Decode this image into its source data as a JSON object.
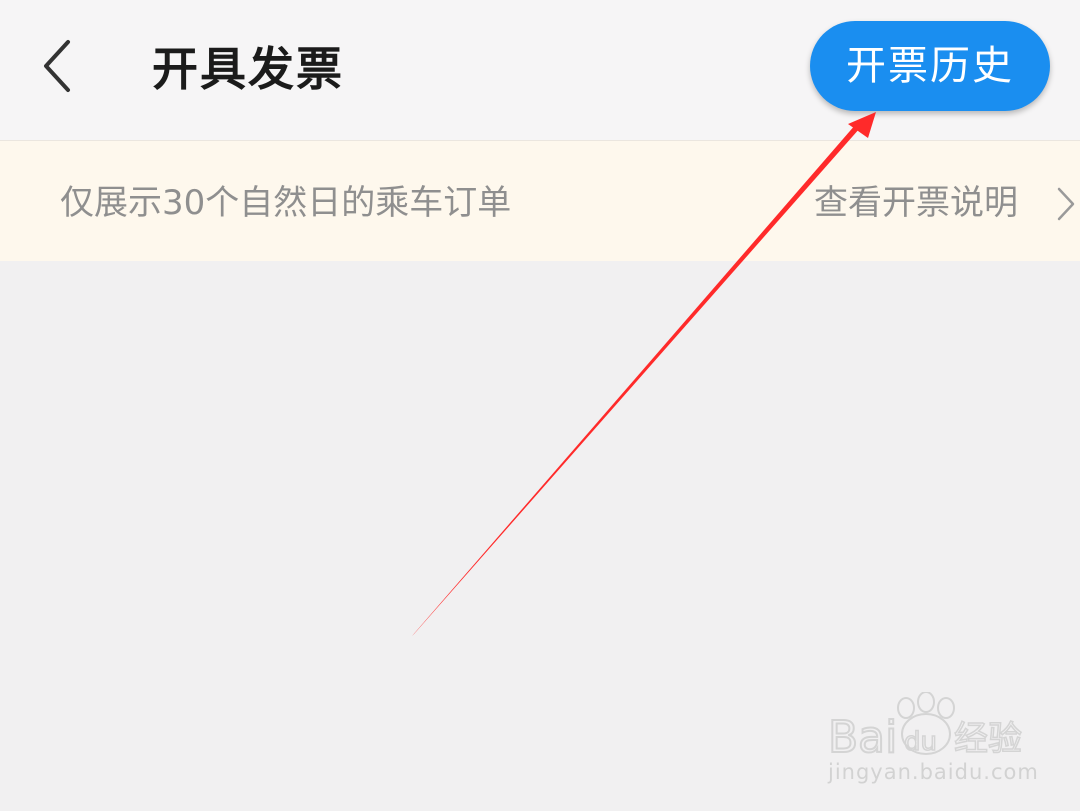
{
  "header": {
    "title": "开具发票",
    "history_button": "开票历史",
    "back_icon": "chevron-left-icon"
  },
  "notice": {
    "text": "仅展示30个自然日的乘车订单",
    "link": "查看开票说明",
    "link_icon": "chevron-right-icon"
  },
  "annotation": {
    "arrow_color": "#ff2a2a"
  },
  "watermark": {
    "logo_text": "Baidu经验",
    "url": "jingyan.baidu.com"
  },
  "colors": {
    "accent": "#1a8ef0",
    "notice_bg": "#fef8ed",
    "page_bg": "#f1f0f1"
  }
}
